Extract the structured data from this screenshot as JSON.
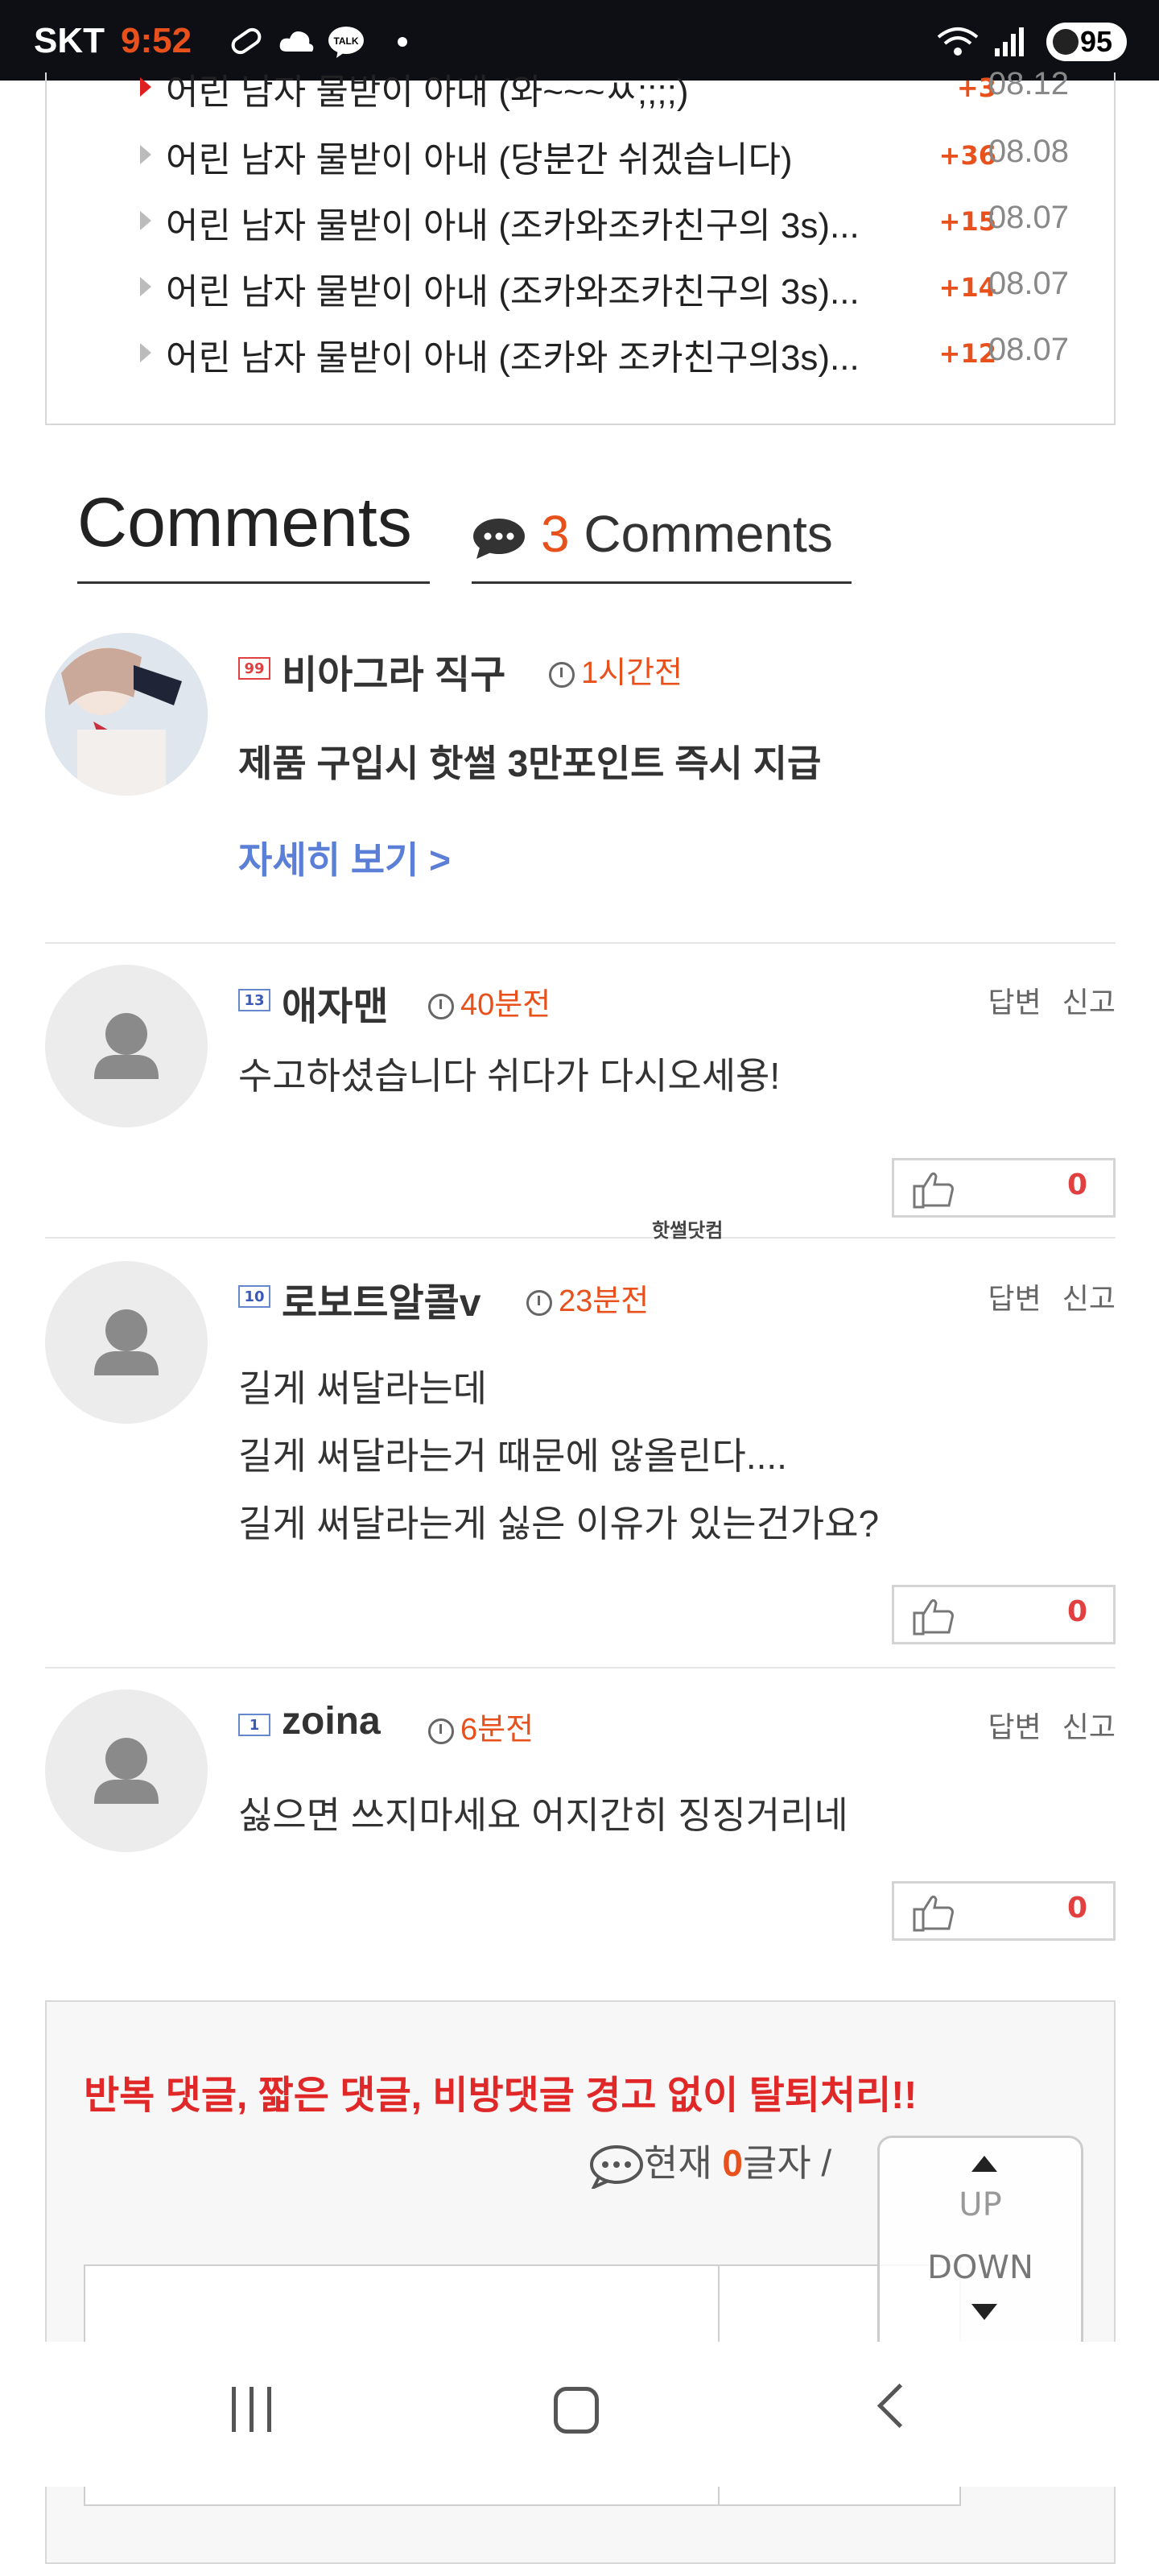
{
  "status_bar": {
    "carrier": "SKT",
    "time": "9:52",
    "battery": "95"
  },
  "related_posts": [
    {
      "title": "어린 남자 물받이 아내 (와~~~ㅆ;;;;)",
      "count": "+3",
      "date": "08.12",
      "highlight": true
    },
    {
      "title": "어린 남자 물받이 아내 (당분간 쉬겠습니다)",
      "count": "+36",
      "date": "08.08",
      "highlight": false
    },
    {
      "title": "어린 남자 물받이 아내 (조카와조카친구의 3s)...",
      "count": "+15",
      "date": "08.07",
      "highlight": false
    },
    {
      "title": "어린 남자 물받이 아내 (조카와조카친구의 3s)...",
      "count": "+14",
      "date": "08.07",
      "highlight": false
    },
    {
      "title": "어린 남자 물받이 아내 (조카와 조카친구의3s)...",
      "count": "+12",
      "date": "08.07",
      "highlight": false
    }
  ],
  "comments_header": {
    "title": "Comments",
    "count": "3",
    "count_label": "Comments"
  },
  "ad_comment": {
    "badge": "99",
    "nickname": "비아그라 직구",
    "time": "1시간전",
    "text": "제품 구입시 핫썰 3만포인트 즉시 지급",
    "link": "자세히 보기 >"
  },
  "comments": [
    {
      "badge": "13",
      "nickname": "애자맨",
      "time": "40분전",
      "reply": "답변",
      "report": "신고",
      "lines": [
        "수고하셨습니다 쉬다가 다시오세용!"
      ],
      "likes": "0"
    },
    {
      "badge": "10",
      "nickname": "로보트알콜v",
      "time": "23분전",
      "reply": "답변",
      "report": "신고",
      "lines": [
        "길게 써달라는데",
        "길게 써달라는거 때문에 않올린다....",
        "길게 써달라는게 싫은 이유가 있는건가요?"
      ],
      "likes": "0"
    },
    {
      "badge": "1",
      "nickname": "zoina",
      "time": "6분전",
      "reply": "답변",
      "report": "신고",
      "lines": [
        "싫으면 쓰지마세요 어지간히 징징거리네"
      ],
      "likes": "0"
    }
  ],
  "watermark": "핫썰닷컴",
  "write_form": {
    "warning": "반복 댓글, 짧은 댓글, 비방댓글 경고 없이 탈퇴처리!!",
    "char_prefix": "현재 ",
    "char_count": "0",
    "char_suffix": "글자 /"
  },
  "scroll_widget": {
    "up": "UP",
    "down": "DOWN"
  },
  "colors": {
    "accent": "#e8501c",
    "warning": "#e02828",
    "link": "#5b7fd6"
  }
}
